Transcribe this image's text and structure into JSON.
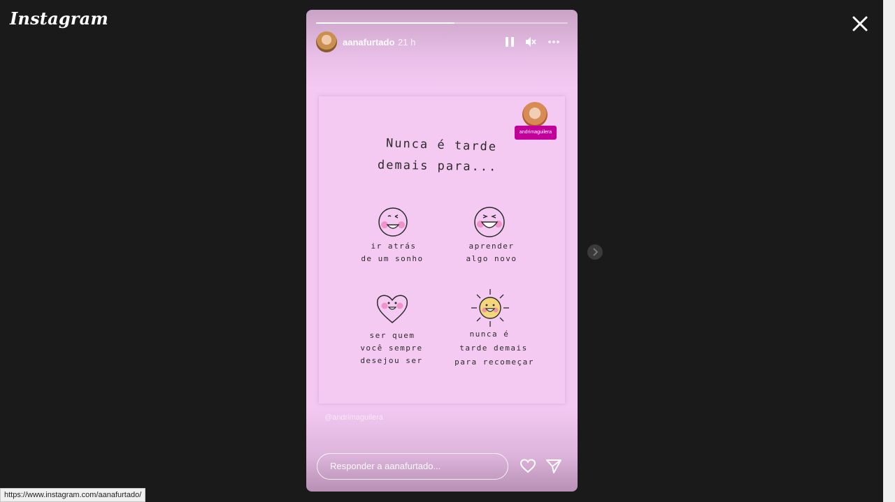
{
  "app": {
    "logo": "Instagram"
  },
  "story": {
    "progress": 0.55,
    "username": "aanafurtado",
    "time_ago": "21 h",
    "controls": [
      "pause-icon",
      "mute-icon",
      "more-icon"
    ],
    "mention_tag": "andrimaguilera",
    "card": {
      "title_line1": "Nunca é tarde",
      "title_line2": "demais para...",
      "items": [
        {
          "line1": "ir atrás",
          "line2": "de um sonho"
        },
        {
          "line1": "aprender",
          "line2": "algo novo"
        },
        {
          "line1": "ser quem",
          "line2": "você sempre",
          "line3": "desejou ser"
        },
        {
          "line1": "nunca é",
          "line2": "tarde demais",
          "line3": "para recomeçar"
        }
      ]
    },
    "watermark": "@andrimaguilera",
    "reply_placeholder": "Responder a aanafurtado..."
  },
  "statusbar": {
    "url": "https://www.instagram.com/aanafurtado/"
  },
  "colors": {
    "background": "#1a1a1a",
    "story_pink": "#f3c9f2",
    "tag_magenta": "#c4009b"
  }
}
